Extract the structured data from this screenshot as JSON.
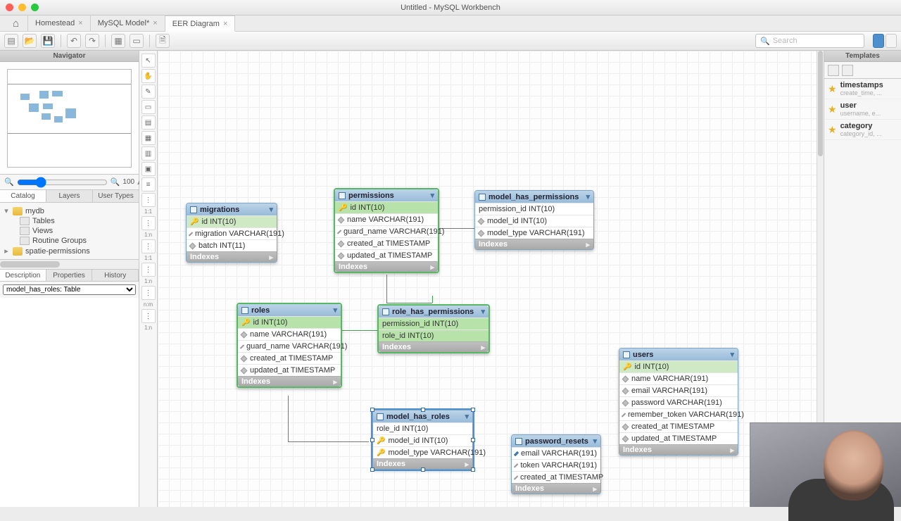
{
  "window": {
    "title": "Untitled - MySQL Workbench"
  },
  "tabs": [
    {
      "label": "Homestead"
    },
    {
      "label": "MySQL Model*"
    },
    {
      "label": "EER Diagram"
    }
  ],
  "toolbar": {
    "search_placeholder": "Search"
  },
  "leftpane": {
    "navigator_title": "Navigator",
    "zoom": "100",
    "subtabs": [
      "Catalog",
      "Layers",
      "User Types"
    ],
    "tree": {
      "db1": "mydb",
      "db1_children": [
        "Tables",
        "Views",
        "Routine Groups"
      ],
      "db2": "spatie-permissions"
    },
    "desc_tabs": [
      "Description",
      "Properties",
      "History"
    ],
    "desc_select": "model_has_roles: Table"
  },
  "palette_labels": [
    "1:1",
    "1:n",
    "1:1",
    "1:n",
    "n:m",
    "1:n"
  ],
  "rightpane": {
    "title": "Templates",
    "items": [
      {
        "name": "timestamps",
        "sub": "create_time, ..."
      },
      {
        "name": "user",
        "sub": "username, e..."
      },
      {
        "name": "category",
        "sub": "category_id, ..."
      }
    ]
  },
  "indexes_label": "Indexes",
  "entities": {
    "migrations": {
      "name": "migrations",
      "cols": [
        {
          "txt": "id INT(10)",
          "key": true
        },
        {
          "txt": "migration VARCHAR(191)"
        },
        {
          "txt": "batch INT(11)"
        }
      ]
    },
    "permissions": {
      "name": "permissions",
      "cols": [
        {
          "txt": "id INT(10)",
          "key": true
        },
        {
          "txt": "name VARCHAR(191)"
        },
        {
          "txt": "guard_name VARCHAR(191)"
        },
        {
          "txt": "created_at TIMESTAMP"
        },
        {
          "txt": "updated_at TIMESTAMP"
        }
      ]
    },
    "model_has_permissions": {
      "name": "model_has_permissions",
      "cols": [
        {
          "txt": "permission_id INT(10)"
        },
        {
          "txt": "model_id INT(10)"
        },
        {
          "txt": "model_type VARCHAR(191)"
        }
      ]
    },
    "roles": {
      "name": "roles",
      "cols": [
        {
          "txt": "id INT(10)",
          "key": true
        },
        {
          "txt": "name VARCHAR(191)"
        },
        {
          "txt": "guard_name VARCHAR(191)"
        },
        {
          "txt": "created_at TIMESTAMP"
        },
        {
          "txt": "updated_at TIMESTAMP"
        }
      ]
    },
    "role_has_permissions": {
      "name": "role_has_permissions",
      "cols": [
        {
          "txt": "permission_id INT(10)"
        },
        {
          "txt": "role_id INT(10)"
        }
      ]
    },
    "users": {
      "name": "users",
      "cols": [
        {
          "txt": "id INT(10)",
          "key": true
        },
        {
          "txt": "name VARCHAR(191)"
        },
        {
          "txt": "email VARCHAR(191)"
        },
        {
          "txt": "password VARCHAR(191)"
        },
        {
          "txt": "remember_token VARCHAR(191)"
        },
        {
          "txt": "created_at TIMESTAMP"
        },
        {
          "txt": "updated_at TIMESTAMP"
        }
      ]
    },
    "model_has_roles": {
      "name": "model_has_roles",
      "cols": [
        {
          "txt": "role_id INT(10)"
        },
        {
          "txt": "model_id INT(10)",
          "key": true
        },
        {
          "txt": "model_type VARCHAR(191)"
        }
      ]
    },
    "password_resets": {
      "name": "password_resets",
      "cols": [
        {
          "txt": "email VARCHAR(191)"
        },
        {
          "txt": "token VARCHAR(191)"
        },
        {
          "txt": "created_at TIMESTAMP"
        }
      ]
    }
  }
}
